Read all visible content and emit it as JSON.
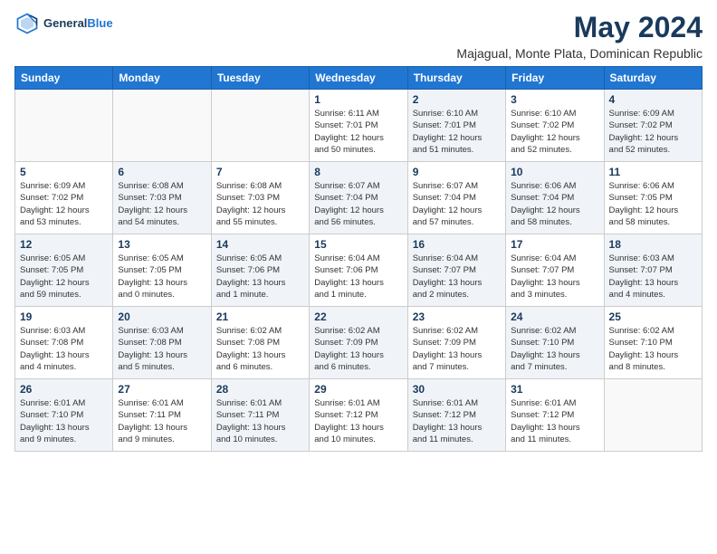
{
  "header": {
    "logo_line1": "General",
    "logo_line2": "Blue",
    "title": "May 2024",
    "subtitle": "Majagual, Monte Plata, Dominican Republic"
  },
  "weekdays": [
    "Sunday",
    "Monday",
    "Tuesday",
    "Wednesday",
    "Thursday",
    "Friday",
    "Saturday"
  ],
  "weeks": [
    [
      {
        "day": "",
        "info": ""
      },
      {
        "day": "",
        "info": ""
      },
      {
        "day": "",
        "info": ""
      },
      {
        "day": "1",
        "info": "Sunrise: 6:11 AM\nSunset: 7:01 PM\nDaylight: 12 hours\nand 50 minutes."
      },
      {
        "day": "2",
        "info": "Sunrise: 6:10 AM\nSunset: 7:01 PM\nDaylight: 12 hours\nand 51 minutes."
      },
      {
        "day": "3",
        "info": "Sunrise: 6:10 AM\nSunset: 7:02 PM\nDaylight: 12 hours\nand 52 minutes."
      },
      {
        "day": "4",
        "info": "Sunrise: 6:09 AM\nSunset: 7:02 PM\nDaylight: 12 hours\nand 52 minutes."
      }
    ],
    [
      {
        "day": "5",
        "info": "Sunrise: 6:09 AM\nSunset: 7:02 PM\nDaylight: 12 hours\nand 53 minutes."
      },
      {
        "day": "6",
        "info": "Sunrise: 6:08 AM\nSunset: 7:03 PM\nDaylight: 12 hours\nand 54 minutes."
      },
      {
        "day": "7",
        "info": "Sunrise: 6:08 AM\nSunset: 7:03 PM\nDaylight: 12 hours\nand 55 minutes."
      },
      {
        "day": "8",
        "info": "Sunrise: 6:07 AM\nSunset: 7:04 PM\nDaylight: 12 hours\nand 56 minutes."
      },
      {
        "day": "9",
        "info": "Sunrise: 6:07 AM\nSunset: 7:04 PM\nDaylight: 12 hours\nand 57 minutes."
      },
      {
        "day": "10",
        "info": "Sunrise: 6:06 AM\nSunset: 7:04 PM\nDaylight: 12 hours\nand 58 minutes."
      },
      {
        "day": "11",
        "info": "Sunrise: 6:06 AM\nSunset: 7:05 PM\nDaylight: 12 hours\nand 58 minutes."
      }
    ],
    [
      {
        "day": "12",
        "info": "Sunrise: 6:05 AM\nSunset: 7:05 PM\nDaylight: 12 hours\nand 59 minutes."
      },
      {
        "day": "13",
        "info": "Sunrise: 6:05 AM\nSunset: 7:05 PM\nDaylight: 13 hours\nand 0 minutes."
      },
      {
        "day": "14",
        "info": "Sunrise: 6:05 AM\nSunset: 7:06 PM\nDaylight: 13 hours\nand 1 minute."
      },
      {
        "day": "15",
        "info": "Sunrise: 6:04 AM\nSunset: 7:06 PM\nDaylight: 13 hours\nand 1 minute."
      },
      {
        "day": "16",
        "info": "Sunrise: 6:04 AM\nSunset: 7:07 PM\nDaylight: 13 hours\nand 2 minutes."
      },
      {
        "day": "17",
        "info": "Sunrise: 6:04 AM\nSunset: 7:07 PM\nDaylight: 13 hours\nand 3 minutes."
      },
      {
        "day": "18",
        "info": "Sunrise: 6:03 AM\nSunset: 7:07 PM\nDaylight: 13 hours\nand 4 minutes."
      }
    ],
    [
      {
        "day": "19",
        "info": "Sunrise: 6:03 AM\nSunset: 7:08 PM\nDaylight: 13 hours\nand 4 minutes."
      },
      {
        "day": "20",
        "info": "Sunrise: 6:03 AM\nSunset: 7:08 PM\nDaylight: 13 hours\nand 5 minutes."
      },
      {
        "day": "21",
        "info": "Sunrise: 6:02 AM\nSunset: 7:08 PM\nDaylight: 13 hours\nand 6 minutes."
      },
      {
        "day": "22",
        "info": "Sunrise: 6:02 AM\nSunset: 7:09 PM\nDaylight: 13 hours\nand 6 minutes."
      },
      {
        "day": "23",
        "info": "Sunrise: 6:02 AM\nSunset: 7:09 PM\nDaylight: 13 hours\nand 7 minutes."
      },
      {
        "day": "24",
        "info": "Sunrise: 6:02 AM\nSunset: 7:10 PM\nDaylight: 13 hours\nand 7 minutes."
      },
      {
        "day": "25",
        "info": "Sunrise: 6:02 AM\nSunset: 7:10 PM\nDaylight: 13 hours\nand 8 minutes."
      }
    ],
    [
      {
        "day": "26",
        "info": "Sunrise: 6:01 AM\nSunset: 7:10 PM\nDaylight: 13 hours\nand 9 minutes."
      },
      {
        "day": "27",
        "info": "Sunrise: 6:01 AM\nSunset: 7:11 PM\nDaylight: 13 hours\nand 9 minutes."
      },
      {
        "day": "28",
        "info": "Sunrise: 6:01 AM\nSunset: 7:11 PM\nDaylight: 13 hours\nand 10 minutes."
      },
      {
        "day": "29",
        "info": "Sunrise: 6:01 AM\nSunset: 7:12 PM\nDaylight: 13 hours\nand 10 minutes."
      },
      {
        "day": "30",
        "info": "Sunrise: 6:01 AM\nSunset: 7:12 PM\nDaylight: 13 hours\nand 11 minutes."
      },
      {
        "day": "31",
        "info": "Sunrise: 6:01 AM\nSunset: 7:12 PM\nDaylight: 13 hours\nand 11 minutes."
      },
      {
        "day": "",
        "info": ""
      }
    ]
  ]
}
